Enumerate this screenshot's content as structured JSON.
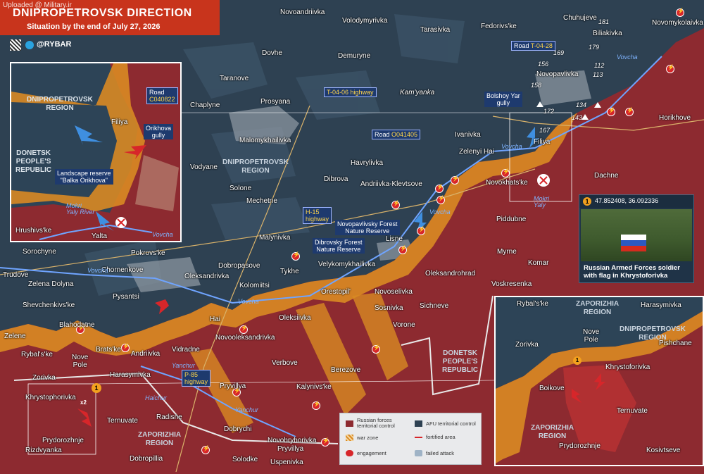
{
  "watermark": "Uploaded @ Military.ir",
  "header": {
    "title": "DNIPROPETROVSK DIRECTION",
    "subtitle": "Situation by the end of July 27, 2026",
    "handle": "@RYBAR",
    "qr_icon": "qr-code-icon",
    "telegram_icon": "telegram-icon"
  },
  "colors": {
    "russian": "#8d2a30",
    "afu": "#2e4152",
    "war_zone": "#d98a23",
    "engagement": "#d7262a"
  },
  "towns": [
    {
      "id": "novoandriivka",
      "name": "Novoandriivka"
    },
    {
      "id": "volodymyrivka",
      "name": "Volodymyrivka"
    },
    {
      "id": "tarasivka",
      "name": "Tarasivka"
    },
    {
      "id": "fedorivske",
      "name": "Fedorivs'ke"
    },
    {
      "id": "chuhujeve",
      "name": "Chuhujeve"
    },
    {
      "id": "biliakivka",
      "name": "Biliakivka"
    },
    {
      "id": "novomykolaivka",
      "name": "Novomykolaivka"
    },
    {
      "id": "dovhe",
      "name": "Dovhe"
    },
    {
      "id": "demuryne",
      "name": "Demuryne"
    },
    {
      "id": "taranove",
      "name": "Taranove"
    },
    {
      "id": "novopavlivka",
      "name": "Novopavlivka"
    },
    {
      "id": "chaplyne",
      "name": "Chaplyne"
    },
    {
      "id": "prosyana",
      "name": "Prosyana"
    },
    {
      "id": "horikhove",
      "name": "Horikhove"
    },
    {
      "id": "malomykhailivka",
      "name": "Malomykhailivka"
    },
    {
      "id": "ivanivka",
      "name": "Ivanivka"
    },
    {
      "id": "filiya",
      "name": "Filiya"
    },
    {
      "id": "zelenyi-hai",
      "name": "Zelenyi Hai"
    },
    {
      "id": "vodyane",
      "name": "Vodyane"
    },
    {
      "id": "havrylivka",
      "name": "Havrylivka"
    },
    {
      "id": "dachne",
      "name": "Dachne"
    },
    {
      "id": "novokhatske",
      "name": "Novokhats'ke"
    },
    {
      "id": "solone",
      "name": "Solone"
    },
    {
      "id": "dibrova",
      "name": "Dibrova"
    },
    {
      "id": "andriivka-klevtsove",
      "name": "Andriivka-Klevtsove"
    },
    {
      "id": "mechetne",
      "name": "Mechetne"
    },
    {
      "id": "piddubne",
      "name": "Piddubne"
    },
    {
      "id": "sorochyne",
      "name": "Sorochyne"
    },
    {
      "id": "malynivka",
      "name": "Malynivka"
    },
    {
      "id": "lisne",
      "name": "Lisne"
    },
    {
      "id": "myrne",
      "name": "Myrne"
    },
    {
      "id": "trudove",
      "name": "Trudove"
    },
    {
      "id": "pokrovske",
      "name": "Pokrovs'ke"
    },
    {
      "id": "chornenkove",
      "name": "Chornenkove"
    },
    {
      "id": "dobropasove",
      "name": "Dobropasove"
    },
    {
      "id": "tykhe",
      "name": "Tykhe"
    },
    {
      "id": "velykomykhailivka",
      "name": "Velykomykhailivka"
    },
    {
      "id": "komar",
      "name": "Komar"
    },
    {
      "id": "zelena-dolyna",
      "name": "Zelena Dolyna"
    },
    {
      "id": "oleksandrivka",
      "name": "Oleksandrivka"
    },
    {
      "id": "oleksandrohrad",
      "name": "Oleksandrohrad"
    },
    {
      "id": "voskresenka",
      "name": "Voskresenka"
    },
    {
      "id": "pysantsi",
      "name": "Pysantsi"
    },
    {
      "id": "kolomiitsi",
      "name": "Kolomiitsi"
    },
    {
      "id": "orestopil",
      "name": "Orestopil'"
    },
    {
      "id": "novoselivka",
      "name": "Novoselivka"
    },
    {
      "id": "shevchenkivske",
      "name": "Shevchenkivs'ke"
    },
    {
      "id": "sosnivka",
      "name": "Sosnivka"
    },
    {
      "id": "sichneve",
      "name": "Sichneve"
    },
    {
      "id": "hai",
      "name": "Hai"
    },
    {
      "id": "oleksiivka",
      "name": "Oleksiivka"
    },
    {
      "id": "vorone",
      "name": "Vorone"
    },
    {
      "id": "blahodatne",
      "name": "Blahodatne"
    },
    {
      "id": "zelene",
      "name": "Zelene"
    },
    {
      "id": "novooleksandrivka",
      "name": "Novooleksandrivka"
    },
    {
      "id": "rybalske",
      "name": "Rybal's'ke"
    },
    {
      "id": "bratske",
      "name": "Brats'ke"
    },
    {
      "id": "andriivka",
      "name": "Andriivka"
    },
    {
      "id": "vidradne",
      "name": "Vidradne"
    },
    {
      "id": "verbove",
      "name": "Verbove"
    },
    {
      "id": "nove-pole",
      "name": "Nove\nPole"
    },
    {
      "id": "berezove",
      "name": "Berezove"
    },
    {
      "id": "zorivka",
      "name": "Zorivka"
    },
    {
      "id": "harasymivka",
      "name": "Harasymivka"
    },
    {
      "id": "pryvillya",
      "name": "Pryvillya"
    },
    {
      "id": "kalynivske",
      "name": "Kalynivs'ke"
    },
    {
      "id": "khrystophorivka",
      "name": "Khrystophorivka"
    },
    {
      "id": "radisne",
      "name": "Radisne"
    },
    {
      "id": "ternuvate",
      "name": "Ternuvate"
    },
    {
      "id": "dobrychi",
      "name": "Dobrychi"
    },
    {
      "id": "novohryhorivka",
      "name": "Novohryhorivka"
    },
    {
      "id": "prydorozhnje",
      "name": "Prydorozhnje"
    },
    {
      "id": "pryvillya-2",
      "name": "Pryvillya"
    },
    {
      "id": "rizdvyanka",
      "name": "Rizdvyanka"
    },
    {
      "id": "dobropillia",
      "name": "Dobropillia"
    },
    {
      "id": "solodke",
      "name": "Solodke"
    },
    {
      "id": "uspenivka",
      "name": "Uspenivka"
    }
  ],
  "regions": [
    {
      "id": "dnipropetrovsk",
      "name": "DNIPROPETROVSK\nREGION"
    },
    {
      "id": "donetsk",
      "name": "DONETSK\nPEOPLE'S\nREPUBLIC"
    },
    {
      "id": "zaporizhia",
      "name": "ZAPORIZHIA\nREGION"
    }
  ],
  "roads": [
    {
      "id": "t0428",
      "prefix": "Road ",
      "code": "T-04-28"
    },
    {
      "id": "t0406",
      "prefix": "",
      "code": "T-04-06 highway"
    },
    {
      "id": "o041405",
      "prefix": "Road ",
      "code": "O041405"
    },
    {
      "id": "h15",
      "prefix": "",
      "code": "H-15\nhighway"
    },
    {
      "id": "p85",
      "prefix": "",
      "code": "P-85\nhighway"
    }
  ],
  "rivers": [
    "Vovcha",
    "Yanchur",
    "Haichur",
    "Vovcha",
    "Vovcha",
    "Vovcha",
    "Yanchur",
    "Vovcha",
    "Mokri\nYaly"
  ],
  "places_misc": {
    "kamyanka": "Kam'yanka",
    "bolshoy_yar": "Bolshoy Yar\ngully",
    "novopavlivsky_forest": "Novopavlivsky Forest\nNature Reserve",
    "dibrovsky_forest": "Dibrovsky Forest\nNature Reserve"
  },
  "distance_marks": [
    "181",
    "169",
    "179",
    "156",
    "112",
    "158",
    "113",
    "134",
    "172",
    "143",
    "167"
  ],
  "inset_left": {
    "region_dp": "DNIPROPETROVSK\nREGION",
    "region_dnr": "DONETSK\nPEOPLE'S\nREPUBLIC",
    "road_prefix": "Road",
    "road_code": "C040822",
    "gully": "Orikhova\ngully",
    "filiya": "Filiya",
    "reserve": "Landscape reserve\n\"Balka Orikhova\"",
    "river": "Mokri\nYaly River",
    "river2": "Vovcha",
    "hrushivske": "Hrushivs'ke",
    "yalta": "Yalta"
  },
  "inset_right": {
    "rybalske": "Rybal's'ke",
    "region_zp_top": "ZAPORIZHIA\nREGION",
    "harasymivka": "Harasymivka",
    "region_dp": "DNIPROPETROVSK\nREGION",
    "nove_pole": "Nove\nPole",
    "pishchane": "Pishchane",
    "zorivka": "Zorivka",
    "khrystoforivka": "Khrystoforivka",
    "boikove": "Boikove",
    "ternuvate": "Ternuvate",
    "region_zp": "ZAPORIZHIA\nREGION",
    "prydorozhnje": "Prydorozhnje",
    "kosivtseve": "Kosivtseve"
  },
  "photo": {
    "marker": "1",
    "coords": "47.852408, 36.092336",
    "caption": "Russian Armed Forces soldier with flag in Khrystoforivka"
  },
  "markers": {
    "khrystophorivka_pin": "1",
    "khrystophorivka_count": "x2",
    "inset_pin": "1"
  },
  "legend": {
    "russian": "Russian forces\nterritorial control",
    "afu": "AFU territorial control",
    "war_zone": "war zone",
    "fortified": "fortified area",
    "engagement": "engagement",
    "failed_attack": "failed attack"
  }
}
